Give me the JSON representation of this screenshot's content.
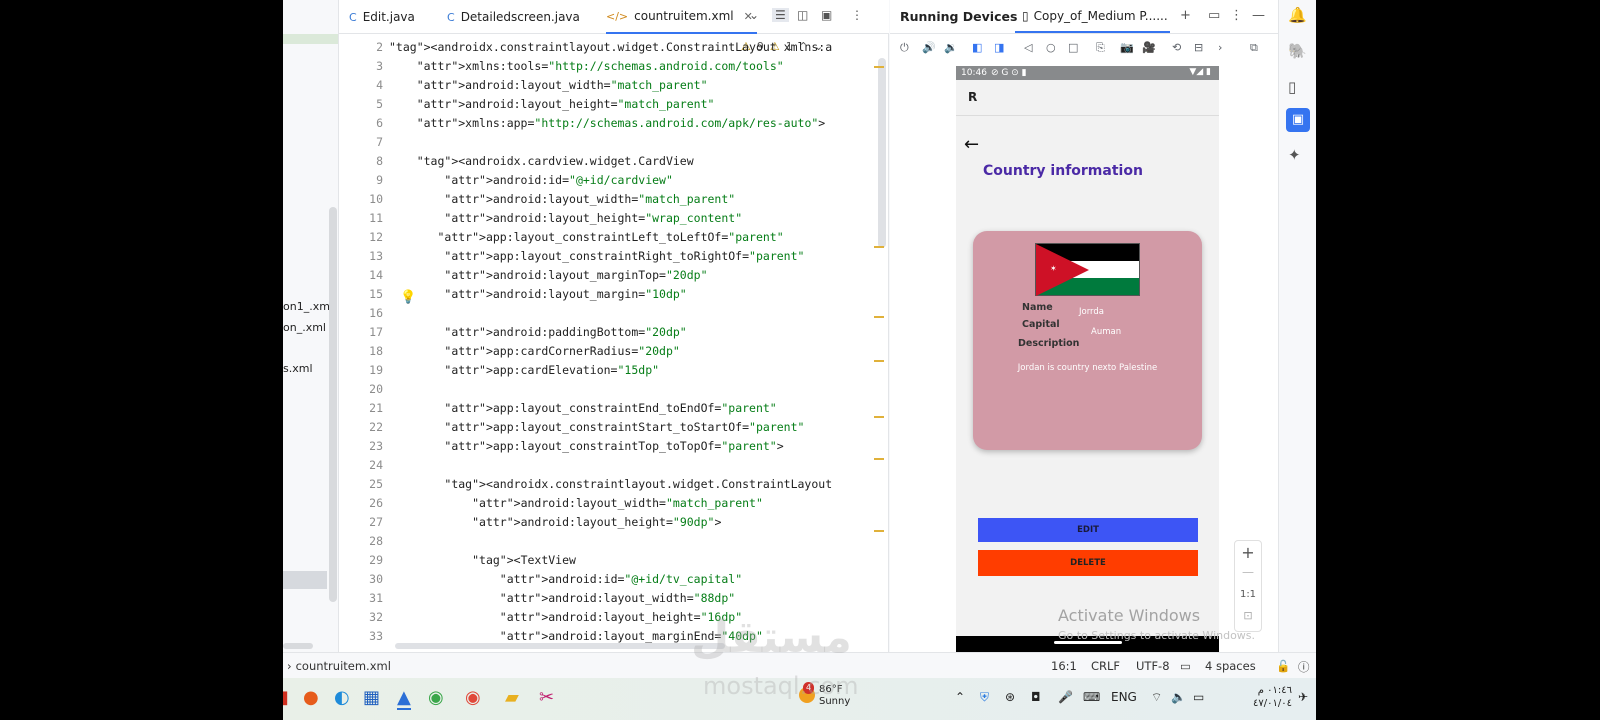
{
  "project": {
    "files": [
      "on1_.xml",
      "on_.xml",
      "s.xml"
    ]
  },
  "editor": {
    "tabs": [
      {
        "label": "Edit.java",
        "icon": "C"
      },
      {
        "label": "Detailedscreen.java",
        "icon": "C"
      },
      {
        "label": "countruitem.xml",
        "icon": "</>"
      }
    ],
    "inspection": {
      "warnings": "9",
      "weak_warnings": "1"
    },
    "lines": [
      {
        "n": "2",
        "text": "<androidx.constraintlayout.widget.ConstraintLayout xmlns:a"
      },
      {
        "n": "3",
        "text": "    xmlns:tools=\"http://schemas.android.com/tools\""
      },
      {
        "n": "4",
        "text": "    android:layout_width=\"match_parent\""
      },
      {
        "n": "5",
        "text": "    android:layout_height=\"match_parent\""
      },
      {
        "n": "6",
        "text": "    xmlns:app=\"http://schemas.android.com/apk/res-auto\">"
      },
      {
        "n": "7",
        "text": ""
      },
      {
        "n": "8",
        "text": "    <androidx.cardview.widget.CardView"
      },
      {
        "n": "9",
        "text": "        android:id=\"@+id/cardview\""
      },
      {
        "n": "10",
        "text": "        android:layout_width=\"match_parent\""
      },
      {
        "n": "11",
        "text": "        android:layout_height=\"wrap_content\""
      },
      {
        "n": "12",
        "text": "       app:layout_constraintLeft_toLeftOf=\"parent\""
      },
      {
        "n": "13",
        "text": "        app:layout_constraintRight_toRightOf=\"parent\""
      },
      {
        "n": "14",
        "text": "        android:layout_marginTop=\"20dp\""
      },
      {
        "n": "15",
        "text": "        android:layout_margin=\"10dp\""
      },
      {
        "n": "16",
        "text": ""
      },
      {
        "n": "17",
        "text": "        android:paddingBottom=\"20dp\""
      },
      {
        "n": "18",
        "text": "        app:cardCornerRadius=\"20dp\""
      },
      {
        "n": "19",
        "text": "        app:cardElevation=\"15dp\""
      },
      {
        "n": "20",
        "text": ""
      },
      {
        "n": "21",
        "text": "        app:layout_constraintEnd_toEndOf=\"parent\""
      },
      {
        "n": "22",
        "text": "        app:layout_constraintStart_toStartOf=\"parent\""
      },
      {
        "n": "23",
        "text": "        app:layout_constraintTop_toTopOf=\"parent\">"
      },
      {
        "n": "24",
        "text": ""
      },
      {
        "n": "25",
        "text": "        <androidx.constraintlayout.widget.ConstraintLayout"
      },
      {
        "n": "26",
        "text": "            android:layout_width=\"match_parent\""
      },
      {
        "n": "27",
        "text": "            android:layout_height=\"90dp\">"
      },
      {
        "n": "28",
        "text": ""
      },
      {
        "n": "29",
        "text": "            <TextView"
      },
      {
        "n": "30",
        "text": "                android:id=\"@+id/tv_capital\""
      },
      {
        "n": "31",
        "text": "                android:layout_width=\"88dp\""
      },
      {
        "n": "32",
        "text": "                android:layout_height=\"16dp\""
      },
      {
        "n": "33",
        "text": "                android:layout_marginEnd=\"40dp\""
      }
    ]
  },
  "devices": {
    "title": "Running Devices",
    "tab_label": "Copy_of_Medium P......"
  },
  "phone": {
    "time": "10:46",
    "appbar_title": "R",
    "page_title": "Country information",
    "card": {
      "name_label": "Name",
      "capital_label": "Capital",
      "description_label": "Description",
      "name_value": "Jorrda",
      "capital_value": "Auman",
      "description_value": "Jordan is country nexto Palestine"
    },
    "edit_label": "EDIT",
    "delete_label": "DELETE"
  },
  "zoom": {
    "plus": "+",
    "minus": "—",
    "ratio": "1:1"
  },
  "windows_notice": {
    "title": "Activate Windows",
    "subtitle": "Go to Settings to activate Windows."
  },
  "status": {
    "file": "countruitem.xml",
    "position": "16:1",
    "line_sep": "CRLF",
    "encoding": "UTF-8",
    "indent": "4 spaces"
  },
  "taskbar": {
    "weather_temp": "86°F",
    "weather_text": "Sunny",
    "weather_badge": "4",
    "language": "ENG",
    "clock_time": "٠١:٤٦ م",
    "clock_date": "٤٧/٠١/٠٤"
  },
  "watermark": {
    "main": "مستقل",
    "sub": "mostaql.com"
  },
  "colors": {
    "accent": "#3574f0",
    "card": "#d29aa6",
    "edit_button": "#3d55f5",
    "delete_button": "#ff3d00",
    "title_purple": "#4b2aa6"
  }
}
